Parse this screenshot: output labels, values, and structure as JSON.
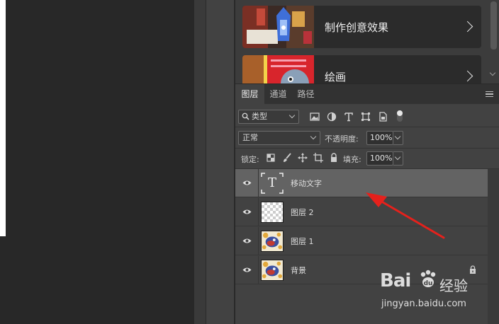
{
  "learn": {
    "cards": [
      {
        "label": "制作创意效果"
      },
      {
        "label": "绘画"
      }
    ]
  },
  "layers_panel": {
    "tabs": [
      {
        "label": "图层",
        "active": true
      },
      {
        "label": "通道",
        "active": false
      },
      {
        "label": "路径",
        "active": false
      }
    ],
    "filter": {
      "kind_label": "类型"
    },
    "blend": {
      "mode": "正常",
      "opacity_label": "不透明度:",
      "opacity_value": "100%"
    },
    "lock": {
      "lock_label": "锁定:",
      "fill_label": "填充:",
      "fill_value": "100%"
    },
    "layers": [
      {
        "name": "移动文字",
        "type": "text",
        "selected": true,
        "thumb_glyph": "T"
      },
      {
        "name": "图层 2",
        "type": "empty",
        "selected": false
      },
      {
        "name": "图层 1",
        "type": "image",
        "selected": false
      },
      {
        "name": "背景",
        "type": "image",
        "selected": false,
        "locked": true
      }
    ]
  },
  "watermark": {
    "brand": "Bai",
    "brand_cn": "经验",
    "url": "jingyan.baidu.com"
  },
  "colors": {
    "panel_bg": "#424242",
    "selected_row": "#636363",
    "arrow": "#e5211c"
  }
}
